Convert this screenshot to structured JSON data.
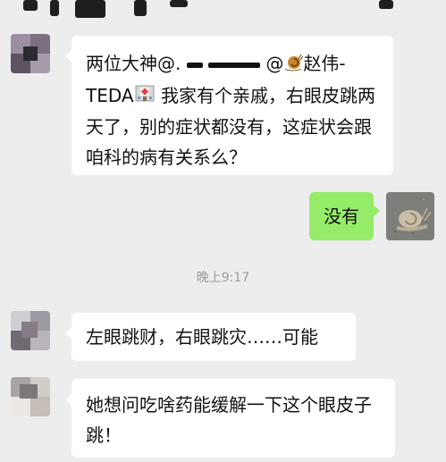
{
  "messages": [
    {
      "side": "left",
      "parts": {
        "a": "两位大神@",
        "b": ".",
        "c": "@",
        "d": "赵伟-",
        "e": "TEDA",
        "f": " 我家有个亲戚，右眼皮跳两天了，别的症状都没有，这症状会跟咱科的病有关系么？"
      },
      "emojis": [
        "snail-emoji",
        "hospital-emoji"
      ]
    },
    {
      "side": "right",
      "text": "没有"
    },
    {
      "side": "left",
      "text": "左眼跳财，右眼跳灾……可能"
    },
    {
      "side": "left",
      "text": "她想问吃啥药能缓解一下这个眼皮子跳！"
    }
  ],
  "timestamp": "晚上9:17",
  "colors": {
    "background": "#ededed",
    "left_bubble": "#ffffff",
    "right_bubble": "#95ec69",
    "timestamp": "#9a9a9a"
  }
}
